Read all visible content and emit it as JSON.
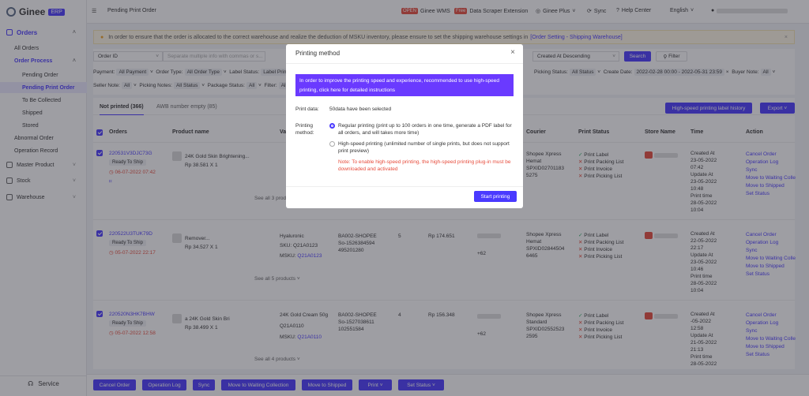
{
  "brand": {
    "name": "Ginee",
    "tag": "ERP"
  },
  "sidebar": {
    "orders": "Orders",
    "all_orders": "All Orders",
    "order_process": "Order Process",
    "pending_order": "Pending Order",
    "pending_print_order": "Pending Print Order",
    "to_be_collected": "To Be Collected",
    "shipped": "Shipped",
    "stored": "Stored",
    "abnormal_order": "Abnormal Order",
    "operation_record": "Operation Record",
    "master_product": "Master Product",
    "stock": "Stock",
    "warehouse": "Warehouse",
    "service": "Service"
  },
  "topbar": {
    "page_title": "Pending Print Order",
    "open_badge": "OPEN",
    "ginee_wms": "Ginee WMS",
    "free_badge": "Free",
    "data_scraper": "Data Scraper Extension",
    "ginee_plus": "Ginee Plus",
    "sync": "Sync",
    "help_center": "Help Center",
    "language": "English"
  },
  "notice": {
    "text": "In order to ensure that the order is allocated to the correct warehouse and realize the deduction of MSKU inventory, please ensure to set the shipping warehouse settings in",
    "link": "[Order Setting - Shipping Warehouse]"
  },
  "filters": {
    "order_id": "Order ID",
    "search_placeholder": "Separate multiple info with commas or s...",
    "sort": "Created At Descending",
    "search_btn": "Search",
    "filter_btn": "Filter",
    "row1": {
      "payment_label": "Payment:",
      "payment_val": "All Payment",
      "ordertype_label": "Order Type:",
      "ordertype_val": "All Order Type",
      "labelstatus_label": "Label Status:",
      "labelstatus_val": "Label Prin",
      "picking_label": "Picking Status:",
      "picking_val": "All Status",
      "createdate_label": "Create Date:",
      "createdate_val": "2022-02-28 00:00 - 2022-05-31 23:59",
      "buyernote_label": "Buyer Note:",
      "buyernote_val": "All"
    },
    "row2": {
      "sellernote_label": "Seller Note:",
      "sellernote_val": "All",
      "pickingnotes_label": "Picking Notes:",
      "pickingnotes_val": "All Status",
      "package_label": "Package Status:",
      "package_val": "All",
      "filter_label": "Filter:",
      "filter_val": "All"
    }
  },
  "tabs": {
    "not_printed": "Not printed (366)",
    "awb_empty": "AWB number empty (85)",
    "history_btn": "High-speed printing label history",
    "export_btn": "Export"
  },
  "table": {
    "headers": {
      "orders": "Orders",
      "product": "Product name",
      "var": "Var",
      "courier": "Courier",
      "print_status": "Print Status",
      "store": "Store Name",
      "time": "Time",
      "action": "Action"
    },
    "rows": [
      {
        "order_id": "220531V3DJC73G",
        "status": "Ready To Ship",
        "deadline": "06-07-2022 07:42",
        "product": "Rp 38.581 X 1",
        "product_name": "24K Gold Skin Brightening...",
        "see_all": "See all 3 products",
        "courier": [
          "Shopee Xpress",
          "Hemat",
          "SPXID02701183",
          "5275"
        ],
        "print": [
          "Print Label",
          "Print Packing List",
          "Print Invoice",
          "Print Picking List"
        ],
        "time": [
          "Created At",
          "23-05-2022",
          "07:42",
          "Update At",
          "23-05-2022",
          "10:48",
          "Print time",
          "28-05-2022",
          "10:04"
        ],
        "actions": [
          "Cancel Order",
          "Operation Log",
          "Sync",
          "Move to Waiting Colle",
          "Move to Shipped",
          "Set Status"
        ]
      },
      {
        "order_id": "220522U3TUK79D",
        "status": "Ready To Ship",
        "deadline": "05-07-2022 22:17",
        "product": "Rp 34.527 X 1",
        "product_name": "Remover...",
        "var": "Hyaluronic",
        "sku_label": "SKU:",
        "sku": "Q21A0123",
        "msku_label": "MSKU:",
        "msku": "Q21A0123",
        "store_sku": [
          "BA002-SHOPEE",
          "So-1526384594",
          "495201280"
        ],
        "qty": "5",
        "price": "Rp 174.651",
        "phone": "+62",
        "see_all": "See all 5 products",
        "courier": [
          "Shopee Xpress",
          "Hemat",
          "SPXID02844504",
          "6465"
        ],
        "print": [
          "Print Label",
          "Print Packing List",
          "Print Invoice",
          "Print Picking List"
        ],
        "time": [
          "Created At",
          "22-05-2022",
          "22:17",
          "Update At",
          "23-05-2022",
          "10:46",
          "Print time",
          "28-05-2022",
          "10:04"
        ],
        "actions": [
          "Cancel Order",
          "Operation Log",
          "Sync",
          "Move to Waiting Colle",
          "Move to Shipped",
          "Set Status"
        ]
      },
      {
        "order_id": "220520N3HK7BHW",
        "status": "Ready To Ship",
        "deadline": "05-07-2022 12:58",
        "product": "Rp 38.499 X 1",
        "product_name": "a 24K Gold Skin Bri",
        "var": "24K Gold Cream 50g",
        "sku": "Q21A0110",
        "msku_label": "MSKU:",
        "msku": "Q21A0110",
        "store_sku": [
          "BA002-SHOPEE",
          "So-1527038611",
          "102551584"
        ],
        "qty": "4",
        "price": "Rp 156.348",
        "phone": "+62",
        "see_all": "See all 4 products",
        "courier": [
          "Shopee Xpress",
          "Standard",
          "SPXID02552523",
          "2595"
        ],
        "print": [
          "Print Label",
          "Print Packing List",
          "Print Invoice",
          "Print Picking List"
        ],
        "time": [
          "Created At",
          "-05-2022",
          "12:58",
          "Update At",
          "21-05-2022",
          "21:13",
          "Print time",
          "28-05-2022"
        ],
        "actions": [
          "Cancel Order",
          "Operation Log",
          "Sync",
          "Move to Waiting Colle",
          "Move to Shipped",
          "Set Status"
        ]
      }
    ]
  },
  "modal": {
    "title": "Printing method",
    "banner": "In order to improve the printing speed and experience, recommended to use high-speed printing, click here for detailed instructions",
    "print_data_label": "Print data:",
    "print_data_val": "50data have been selected",
    "method_label": "Printing method:",
    "option1": "Regular printing (print up to 100 orders in one time, generate a PDF label for all orders, and will takes more time)",
    "option2": "High-speed printing (unlimited number of single prints, but does not support print preview)",
    "note": "Note: To enable high-speed printing, the high-speed printing plug-in must be downloaded and activated",
    "start_btn": "Start printing"
  },
  "bottombar": {
    "cancel": "Cancel Order",
    "log": "Operation Log",
    "sync": "Sync",
    "waiting": "Move to Waiting Collection",
    "shipped": "Move to Shipped",
    "print": "Print",
    "set_status": "Set Status"
  }
}
